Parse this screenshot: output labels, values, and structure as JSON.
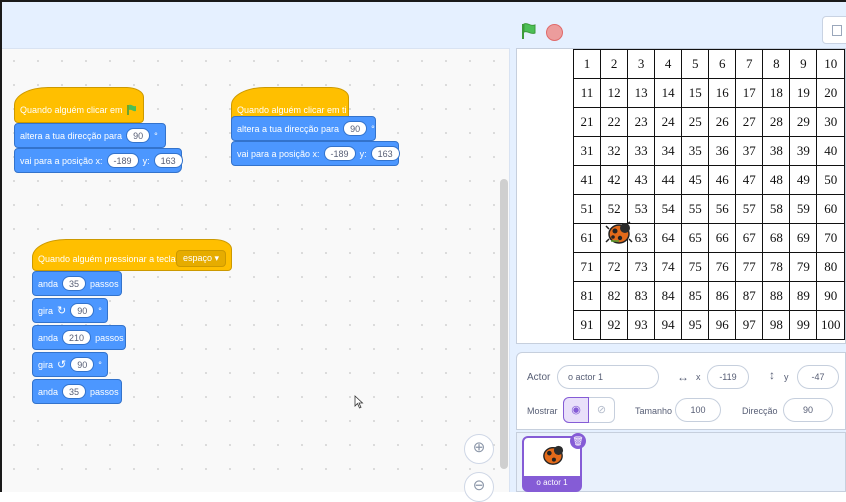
{
  "code": {
    "script1": {
      "hat": "Quando alguém clicar em",
      "turn_label": "altera a tua direcção para",
      "turn_value": "90",
      "deg": "°",
      "goto_label": "vai para a posição x:",
      "x": "-189",
      "y_label": "y:",
      "y": "163"
    },
    "script2": {
      "hat": "Quando alguém clicar em ti",
      "turn_label": "altera a tua direcção para",
      "turn_value": "90",
      "deg": "°",
      "goto_label": "vai para a posição x:",
      "x": "-189",
      "y_label": "y:",
      "y": "163"
    },
    "script3": {
      "hat": "Quando alguém pressionar a tecla",
      "key": "espaço ▾",
      "b1_label": "anda",
      "b1_value": "35",
      "b1_unit": "passos",
      "b2_label": "gira",
      "b2_value": "90",
      "b2_icon": "↻",
      "deg": "°",
      "b3_label": "anda",
      "b3_value": "210",
      "b3_unit": "passos",
      "b4_label": "gira",
      "b4_value": "90",
      "b4_icon": "↺",
      "b5_label": "anda",
      "b5_value": "35",
      "b5_unit": "passos"
    },
    "zoom_in": "⊕",
    "zoom_out": "⊖"
  },
  "stage": {
    "grid": [
      [
        "1",
        "2",
        "3",
        "4",
        "5",
        "6",
        "7",
        "8",
        "9",
        "10"
      ],
      [
        "11",
        "12",
        "13",
        "14",
        "15",
        "16",
        "17",
        "18",
        "19",
        "20"
      ],
      [
        "21",
        "22",
        "23",
        "24",
        "25",
        "26",
        "27",
        "28",
        "29",
        "30"
      ],
      [
        "31",
        "32",
        "33",
        "34",
        "35",
        "36",
        "37",
        "38",
        "39",
        "40"
      ],
      [
        "41",
        "42",
        "43",
        "44",
        "45",
        "46",
        "47",
        "48",
        "49",
        "50"
      ],
      [
        "51",
        "52",
        "53",
        "54",
        "55",
        "56",
        "57",
        "58",
        "59",
        "60"
      ],
      [
        "61",
        "",
        "63",
        "64",
        "65",
        "66",
        "67",
        "68",
        "69",
        "70"
      ],
      [
        "71",
        "72",
        "73",
        "74",
        "75",
        "76",
        "77",
        "78",
        "79",
        "80"
      ],
      [
        "81",
        "82",
        "83",
        "84",
        "85",
        "86",
        "87",
        "88",
        "89",
        "90"
      ],
      [
        "91",
        "92",
        "93",
        "94",
        "95",
        "96",
        "97",
        "98",
        "99",
        "100"
      ]
    ]
  },
  "sprite_info": {
    "actor_label": "Actor",
    "actor_name": "o actor 1",
    "x_label": "x",
    "x_value": "-119",
    "y_label": "y",
    "y_value": "-47",
    "show_label": "Mostrar",
    "size_label": "Tamanho",
    "size_value": "100",
    "direction_label": "Direcção",
    "direction_value": "90"
  },
  "sprites": [
    {
      "name": "o actor 1"
    }
  ],
  "colors": {
    "motion": "#4c97ff",
    "events": "#ffbf00",
    "selected": "#855cd6"
  }
}
